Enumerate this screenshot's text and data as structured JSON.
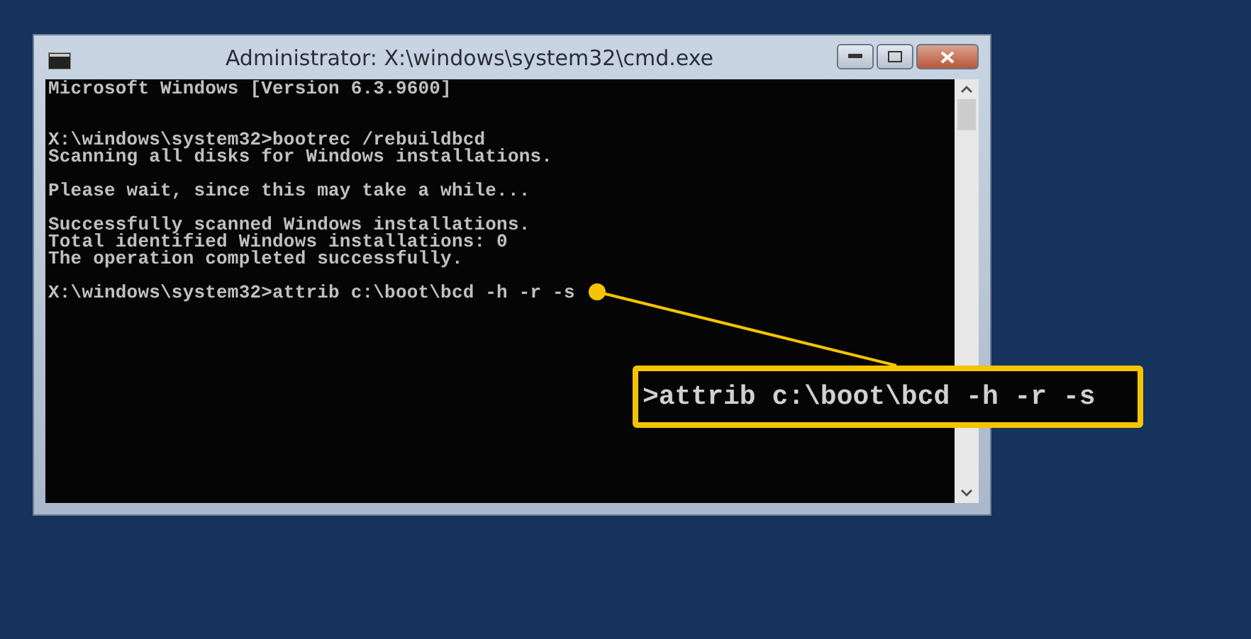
{
  "window": {
    "title": "Administrator: X:\\windows\\system32\\cmd.exe"
  },
  "console": {
    "banner": "Microsoft Windows [Version 6.3.9600]",
    "blocks": [
      [
        "X:\\windows\\system32>bootrec /rebuildbcd",
        "Scanning all disks for Windows installations."
      ],
      [
        "Please wait, since this may take a while..."
      ],
      [
        "Successfully scanned Windows installations.",
        "Total identified Windows installations: 0",
        "The operation completed successfully."
      ],
      [
        "X:\\windows\\system32>attrib c:\\boot\\bcd -h -r -s"
      ]
    ]
  },
  "callout": {
    "text": ">attrib c:\\boot\\bcd -h -r -s"
  }
}
